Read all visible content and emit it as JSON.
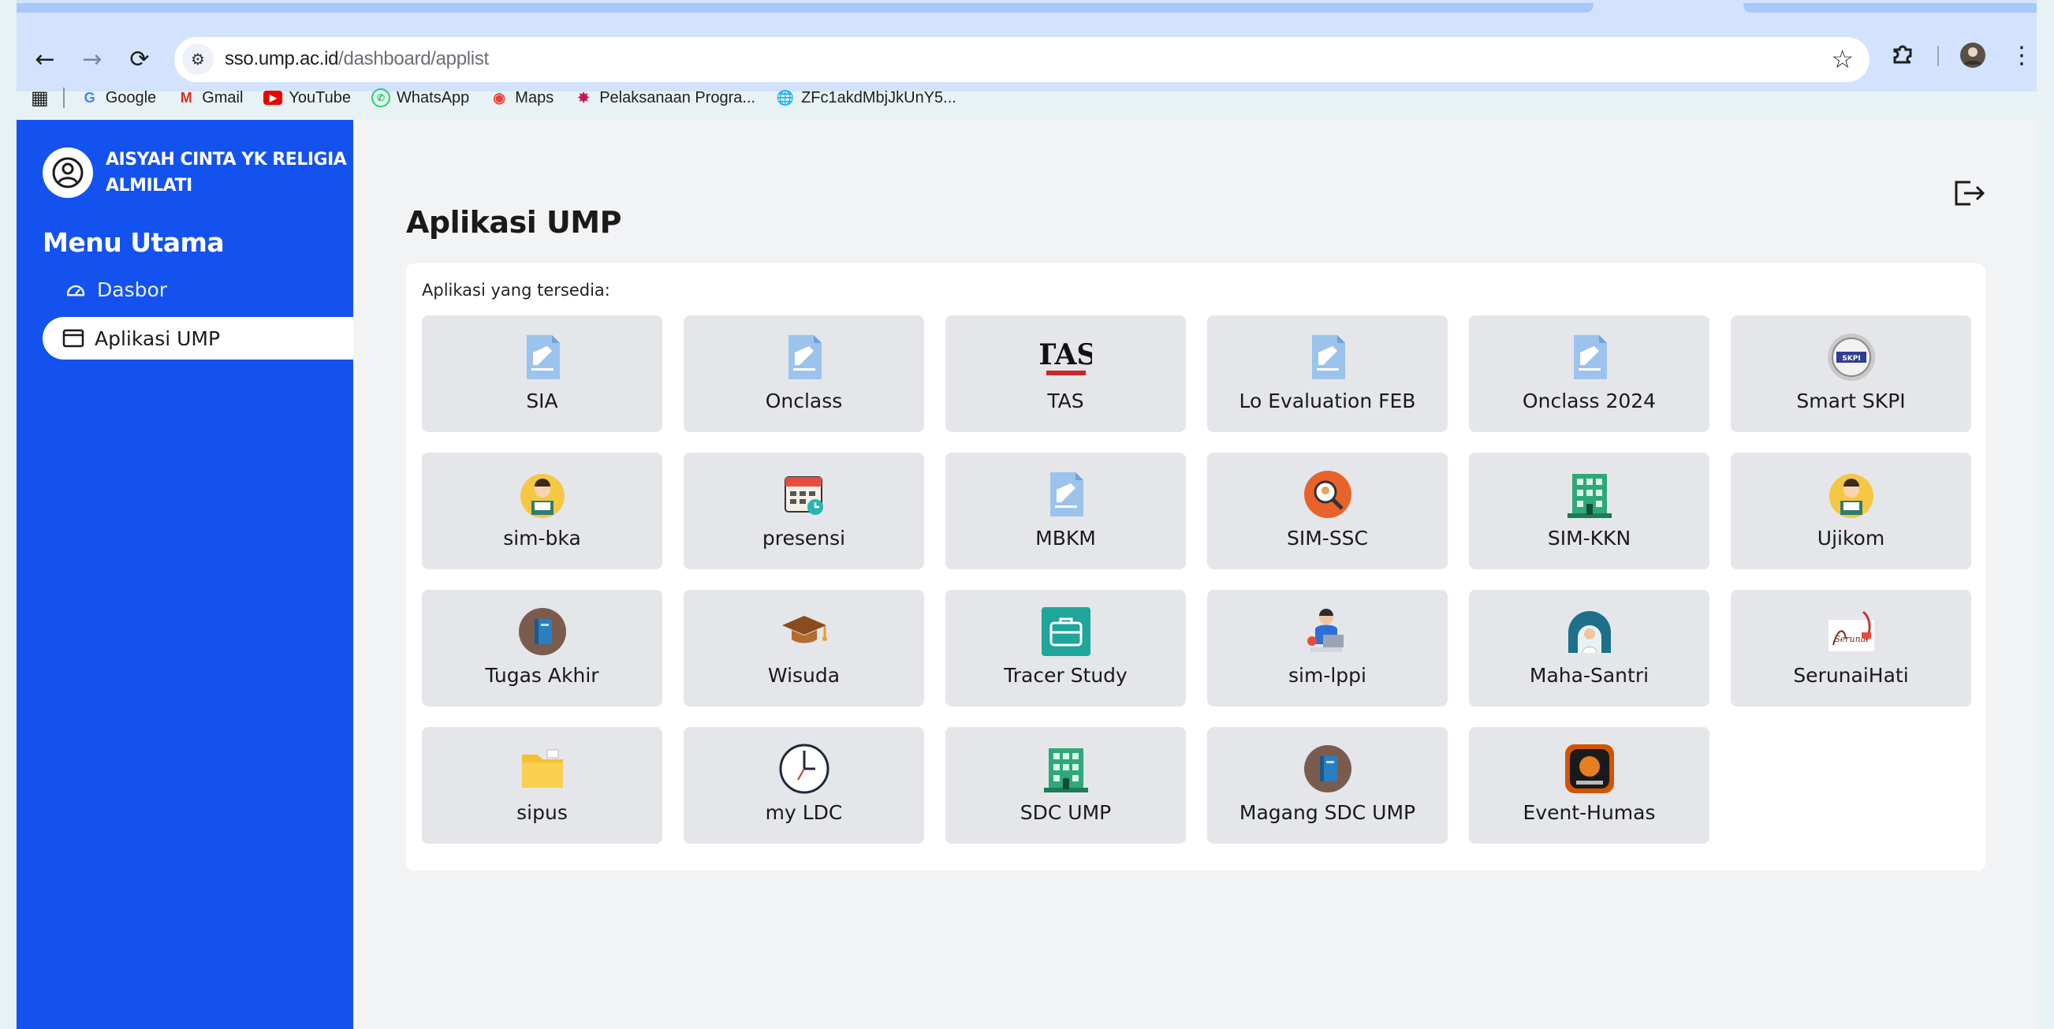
{
  "browser": {
    "url_host": "sso.ump.ac.id",
    "url_path": "/dashboard/applist",
    "bookmarks": [
      {
        "label": "Google",
        "icon": "google-icon"
      },
      {
        "label": "Gmail",
        "icon": "gmail-icon"
      },
      {
        "label": "YouTube",
        "icon": "youtube-icon"
      },
      {
        "label": "WhatsApp",
        "icon": "whatsapp-icon"
      },
      {
        "label": "Maps",
        "icon": "maps-icon"
      },
      {
        "label": "Pelaksanaan Progra...",
        "icon": "pinwheel-icon"
      },
      {
        "label": "ZFc1akdMbjJkUnY5...",
        "icon": "globe-icon"
      }
    ]
  },
  "sidebar": {
    "user_name": "AISYAH CINTA YK RELIGIA ALMILATI",
    "menu_title": "Menu Utama",
    "items": [
      {
        "label": "Dasbor",
        "icon": "speedometer-icon"
      },
      {
        "label": "Aplikasi UMP",
        "icon": "window-icon"
      }
    ]
  },
  "main": {
    "title": "Aplikasi UMP",
    "card_label": "Aplikasi yang tersedia:",
    "apps": [
      {
        "label": "SIA",
        "icon": "document-icon"
      },
      {
        "label": "Onclass",
        "icon": "document-icon"
      },
      {
        "label": "TAS",
        "icon": "tas-logo-icon"
      },
      {
        "label": "Lo Evaluation FEB",
        "icon": "document-icon"
      },
      {
        "label": "Onclass 2024",
        "icon": "document-icon"
      },
      {
        "label": "Smart SKPI",
        "icon": "skpi-badge-icon"
      },
      {
        "label": "sim-bka",
        "icon": "user-desk-icon"
      },
      {
        "label": "presensi",
        "icon": "calendar-icon"
      },
      {
        "label": "MBKM",
        "icon": "document-icon"
      },
      {
        "label": "SIM-SSC",
        "icon": "magnifier-icon"
      },
      {
        "label": "SIM-KKN",
        "icon": "building-icon"
      },
      {
        "label": "Ujikom",
        "icon": "user-desk-icon"
      },
      {
        "label": "Tugas Akhir",
        "icon": "book-icon"
      },
      {
        "label": "Wisuda",
        "icon": "graduation-cap-icon"
      },
      {
        "label": "Tracer Study",
        "icon": "briefcase-icon"
      },
      {
        "label": "sim-lppi",
        "icon": "person-laptop-icon"
      },
      {
        "label": "Maha-Santri",
        "icon": "mosque-icon"
      },
      {
        "label": "SerunaiHati",
        "icon": "serunaihati-logo-icon"
      },
      {
        "label": "sipus",
        "icon": "folder-icon"
      },
      {
        "label": "my LDC",
        "icon": "clock-icon"
      },
      {
        "label": "SDC UMP",
        "icon": "building-icon"
      },
      {
        "label": "Magang SDC UMP",
        "icon": "book-icon"
      },
      {
        "label": "Event-Humas",
        "icon": "radio-icon"
      }
    ]
  },
  "colors": {
    "sidebar": "#1452f0",
    "page_bg": "#f2f3f5",
    "tile_bg": "#e4e6ea",
    "chrome": "#d3e3fd"
  }
}
